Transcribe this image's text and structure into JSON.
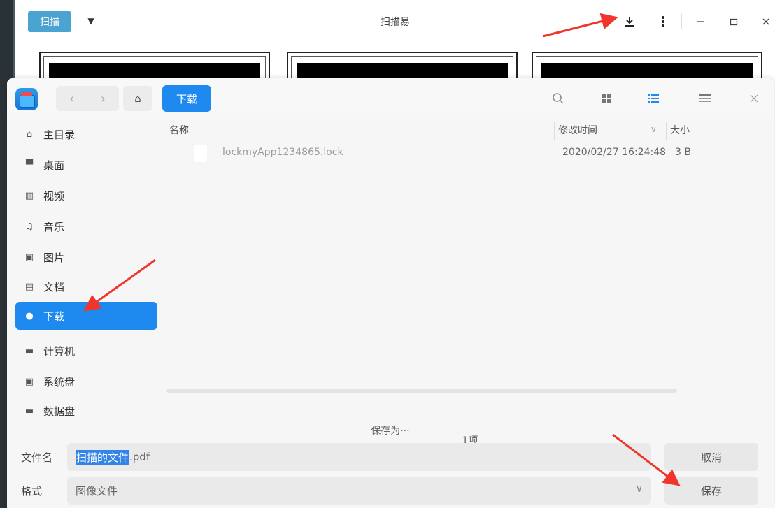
{
  "app": {
    "scan_button": "扫描",
    "title": "扫描易"
  },
  "dialog": {
    "breadcrumb": "下载",
    "sidebar": [
      {
        "label": "主目录",
        "icon": "home-icon"
      },
      {
        "label": "桌面",
        "icon": "desktop-icon"
      },
      {
        "label": "视频",
        "icon": "video-icon"
      },
      {
        "label": "音乐",
        "icon": "music-icon"
      },
      {
        "label": "图片",
        "icon": "picture-icon"
      },
      {
        "label": "文档",
        "icon": "document-icon"
      },
      {
        "label": "下载",
        "icon": "download-icon",
        "active": true
      },
      {
        "label": "计算机",
        "icon": "computer-icon"
      },
      {
        "label": "系统盘",
        "icon": "disk-icon"
      },
      {
        "label": "数据盘",
        "icon": "disk-icon"
      }
    ],
    "columns": {
      "name": "名称",
      "modified": "修改时间",
      "size": "大小"
    },
    "files": [
      {
        "name": "lockmyApp1234865.lock",
        "modified": "2020/02/27 16:24:48",
        "size": "3 B"
      }
    ],
    "count": "1项",
    "save_as": "保存为···",
    "filename_label": "文件名",
    "filename_selected": "扫描的文件",
    "filename_ext": ".pdf",
    "format_label": "格式",
    "format_value": "图像文件",
    "cancel_label": "取消",
    "save_label": "保存"
  },
  "colors": {
    "accent": "#1e8af0",
    "scan_button": "#4aa3d0",
    "annotation_arrow": "#f0362c"
  }
}
